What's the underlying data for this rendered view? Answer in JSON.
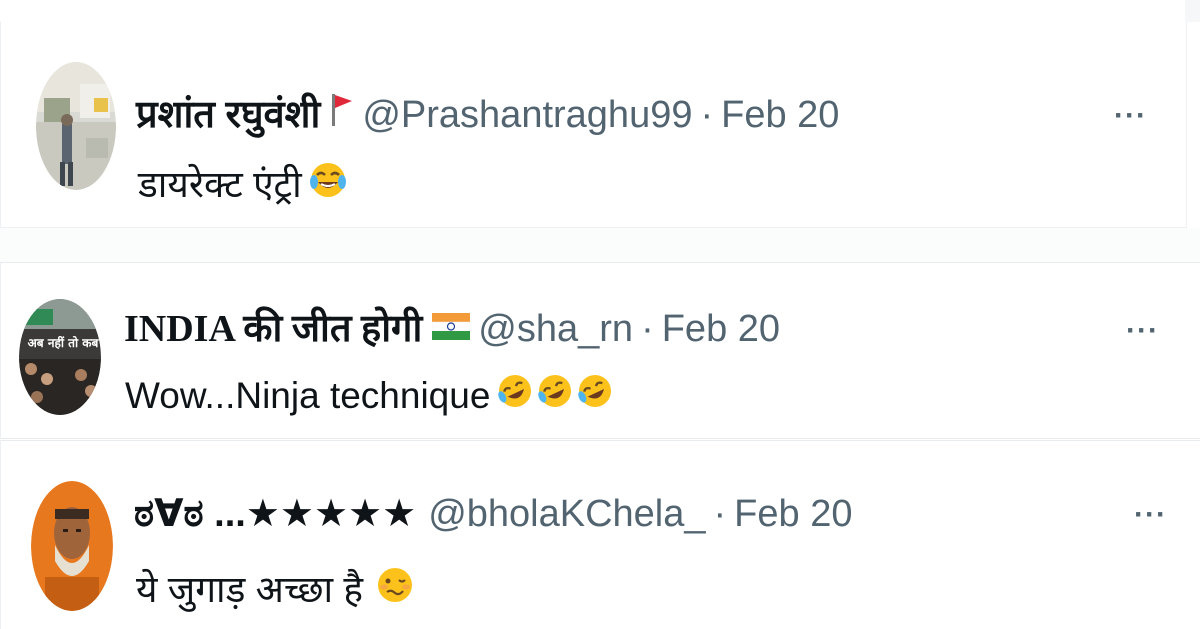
{
  "tweets": [
    {
      "display_name": "प्रशांत रघुवंशी",
      "badge_icon": "red-flag-icon",
      "handle": "@Prashantraghu99",
      "separator": "·",
      "date": "Feb 20",
      "text": "डायरेक्ट एंट्री",
      "emoji_icon": "face-with-tears-of-joy-icon",
      "more_label": "···"
    },
    {
      "display_name": "INDIA की जीत होगी",
      "badge_icon": "india-flag-icon",
      "handle": "@sha_rn",
      "separator": "·",
      "date": "Feb 20",
      "text": "Wow...Ninja technique",
      "emoji_icon": "rolling-on-floor-laughing-icon",
      "emoji_count": 3,
      "avatar_text": "अब नहीं तो कब",
      "more_label": "···"
    },
    {
      "display_name": "ಠ∀ಠ ...★★★★★",
      "handle": "@bholaKChela_",
      "separator": "·",
      "date": "Feb 20",
      "text": "ये जुगाड़ अच्छा है",
      "emoji_icon": "woozy-face-icon",
      "more_label": "···"
    }
  ],
  "colors": {
    "text": "#0f1419",
    "secondary": "#536471",
    "divider": "#eef1f3"
  }
}
